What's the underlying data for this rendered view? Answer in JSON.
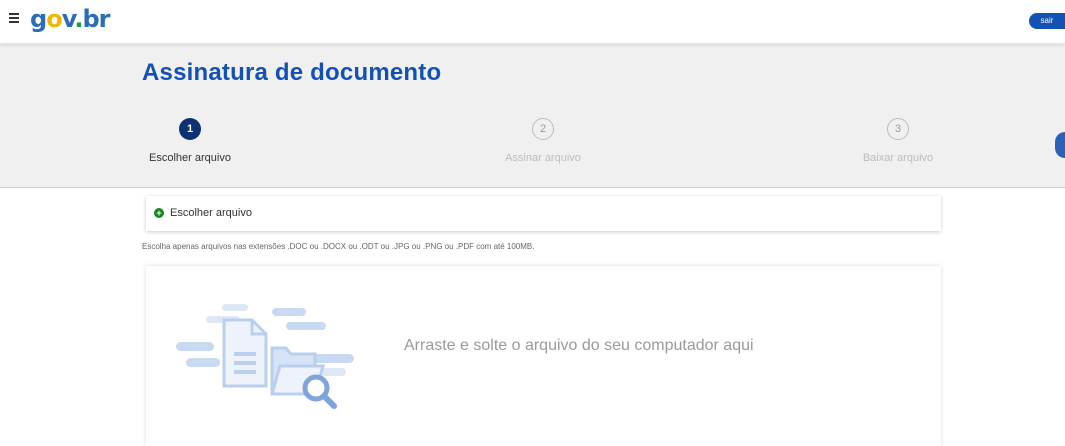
{
  "header": {
    "logo": {
      "g": "g",
      "o": "o",
      "v": "v",
      "dot": ".",
      "br": "br"
    },
    "logout_label": "sair"
  },
  "page": {
    "title": "Assinatura de documento"
  },
  "steps": [
    {
      "number": "1",
      "label": "Escolher arquivo",
      "state": "active"
    },
    {
      "number": "2",
      "label": "Assinar arquivo",
      "state": "inactive"
    },
    {
      "number": "3",
      "label": "Baixar arquivo",
      "state": "inactive"
    }
  ],
  "upload": {
    "header_label": "Escolher arquivo",
    "hint": "Escolha apenas arquivos nas extensões .DOC ou .DOCX ou .ODT ou .JPG ou .PNG ou .PDF com até 100MB.",
    "drop_text": "Arraste e solte o arquivo do seu computador aqui"
  },
  "icons": [
    "menu-icon",
    "plus-circle-icon",
    "document-icon",
    "folder-icon",
    "magnifier-icon"
  ],
  "colors": {
    "primary": "#1351b4",
    "step_active": "#0c326f",
    "add_green": "#168821",
    "illustration": "#b9cfee"
  }
}
